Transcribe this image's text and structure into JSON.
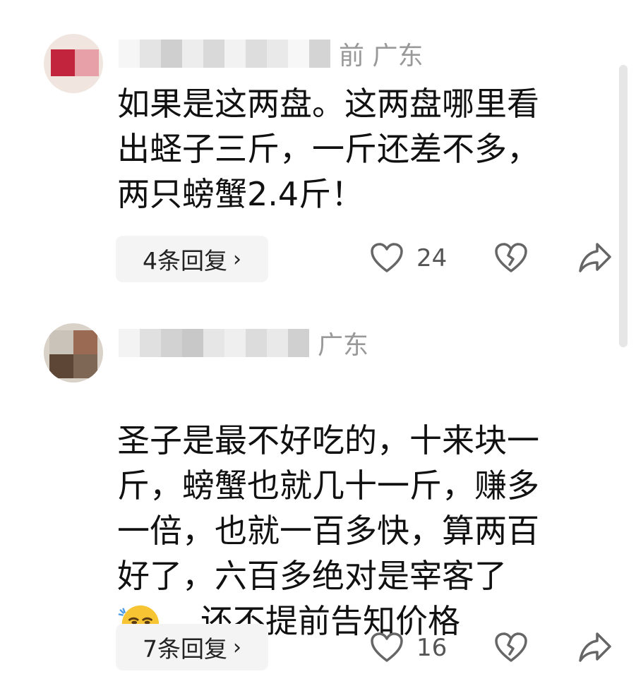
{
  "comments": [
    {
      "meta": "前 广东",
      "text": "如果是这两盘。这两盘哪里看\n出蛏子三斤，一斤还差不多，\n两只螃蟹2.4斤！",
      "replies_label": "4条回复",
      "likes": "24"
    },
    {
      "meta": "广东",
      "text_before_emoji": "圣子是最不好吃的，十来块一\n斤，螃蟹也就几十一斤，赚多\n一倍，也就一百多快，算两百\n好了，六百多绝对是宰客了\n",
      "emoji": "smirk-emoji",
      "text_after_emoji": "，还不提前告知价格",
      "replies_label": "7条回复",
      "likes": "16"
    }
  ],
  "icons": {
    "like": "heart-outline-icon",
    "dislike": "broken-heart-icon",
    "share": "share-arrow-icon",
    "chevron": "chevron-right-icon"
  },
  "colors": {
    "text": "#111111",
    "meta": "#999999",
    "pill_bg": "#f4f4f4",
    "icon": "#666666"
  }
}
